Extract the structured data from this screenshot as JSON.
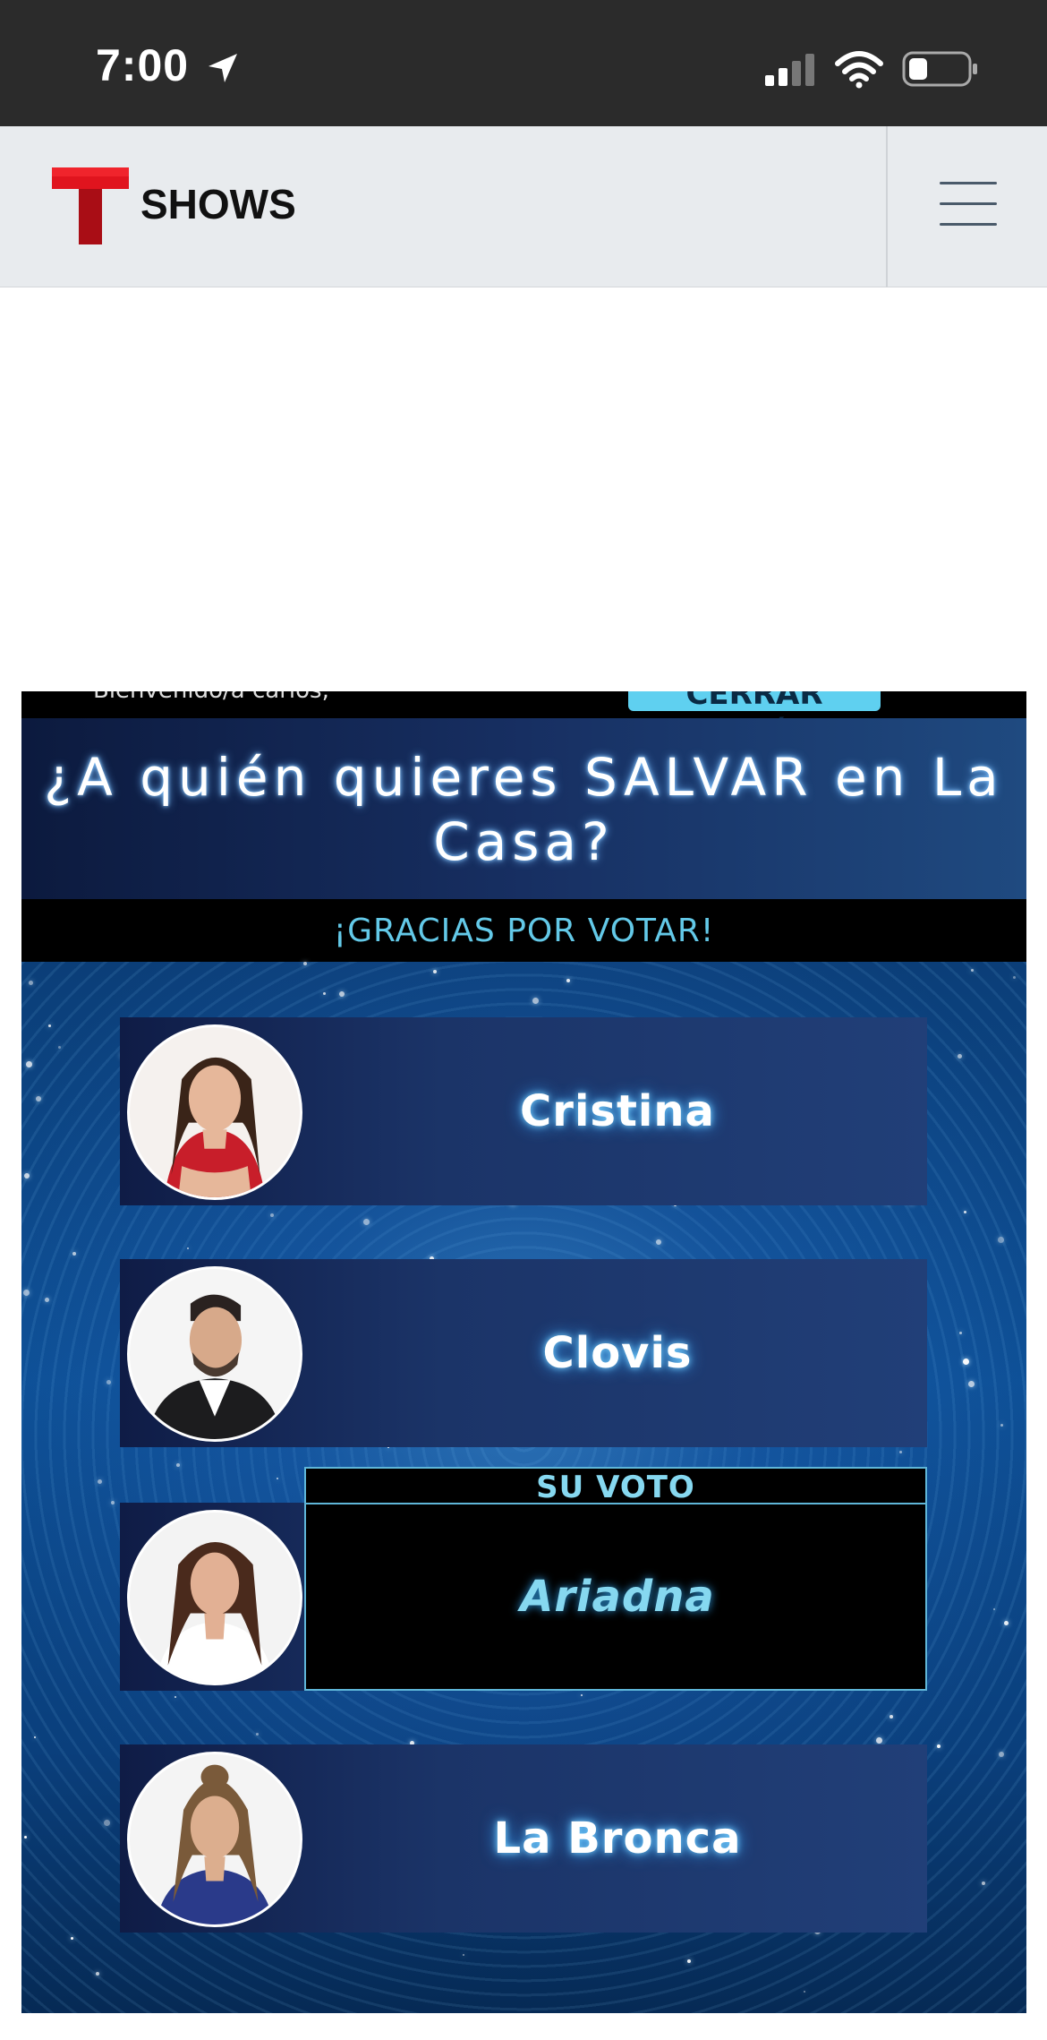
{
  "status_bar": {
    "time": "7:00"
  },
  "header": {
    "brand_name": "SHOWS",
    "menu_icon": "hamburger-menu-icon"
  },
  "widget": {
    "welcome_text": "Bienvenido/a carlos,",
    "logout_label": "CERRAR SESIÓN",
    "title": "¿A quién quieres SALVAR en La Casa?",
    "thanks_message": "¡GRACIAS POR VOTAR!",
    "vote_label": "SU VOTO",
    "candidates": [
      {
        "name": "Cristina",
        "voted": false
      },
      {
        "name": "Clovis",
        "voted": false
      },
      {
        "name": "Ariadna",
        "voted": true
      },
      {
        "name": "La Bronca",
        "voted": false
      }
    ]
  },
  "colors": {
    "accent": "#63c9e8",
    "logo_red": "#e0141e",
    "panel_dark": "#0f1c46"
  }
}
